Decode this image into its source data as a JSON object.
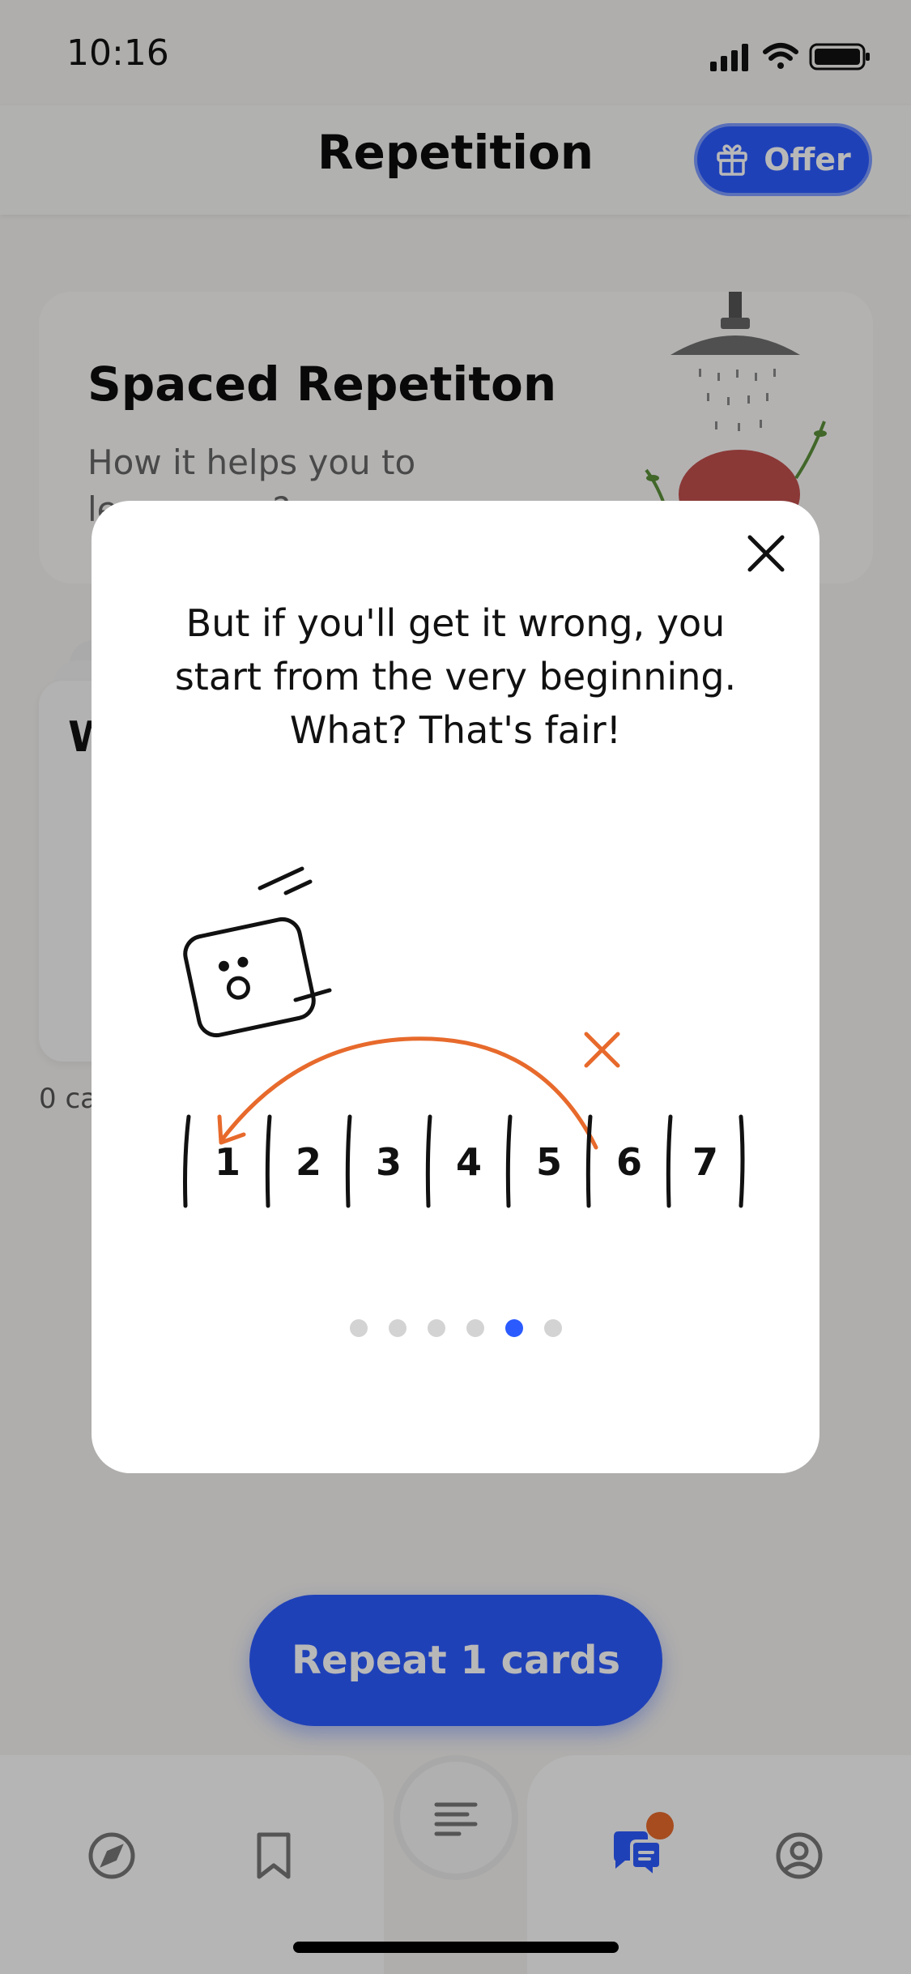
{
  "status_bar": {
    "time": "10:16"
  },
  "header": {
    "title": "Repetition",
    "offer_label": "Offer"
  },
  "spaced_card": {
    "title": "Spaced Repetiton",
    "subtitle": "How it helps you to learn more?"
  },
  "stack_card": {
    "letter": "W",
    "caption": "0 cards"
  },
  "repeat_button": {
    "label": "Repeat 1 cards"
  },
  "modal": {
    "text_line1": "But if you'll get it wrong, you",
    "text_line2": "start from the very beginning.",
    "text_line3": "What? That's fair!",
    "steps": [
      "1",
      "2",
      "3",
      "4",
      "5",
      "6",
      "7"
    ],
    "pager": {
      "total": 6,
      "active_index": 4
    }
  },
  "tabbar": {
    "items": [
      "compass-icon",
      "bookmark-icon",
      "list-icon",
      "chat-icon",
      "profile-icon"
    ],
    "active": "chat-icon",
    "notification": true
  },
  "colors": {
    "accent": "#2b5bff",
    "orange": "#e76a2c",
    "dim_overlay": "rgba(0,0,0,0.28)"
  }
}
